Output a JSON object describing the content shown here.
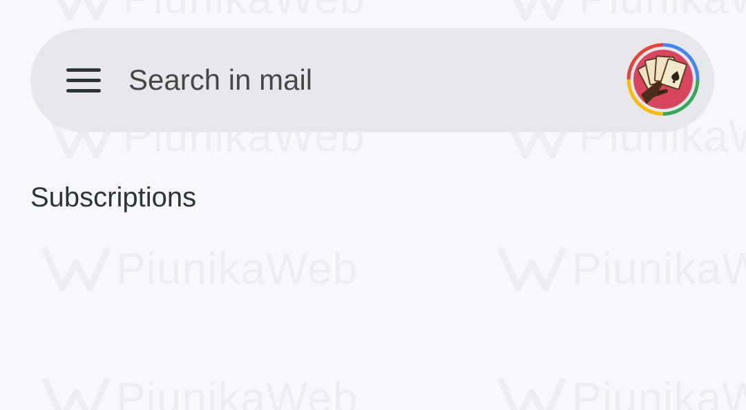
{
  "search": {
    "placeholder": "Search in mail"
  },
  "content": {
    "section_title": "Subscriptions"
  },
  "watermark": {
    "text": "PiunikaWeb"
  },
  "icons": {
    "menu": "hamburger-menu-icon",
    "avatar": "account-avatar"
  },
  "colors": {
    "background": "#f6f8fc",
    "search_bar": "#e7e8ec",
    "text_primary": "#2f3237",
    "avatar_ring": [
      "#4285f4",
      "#ea4335",
      "#fbbc05",
      "#34a853"
    ]
  }
}
